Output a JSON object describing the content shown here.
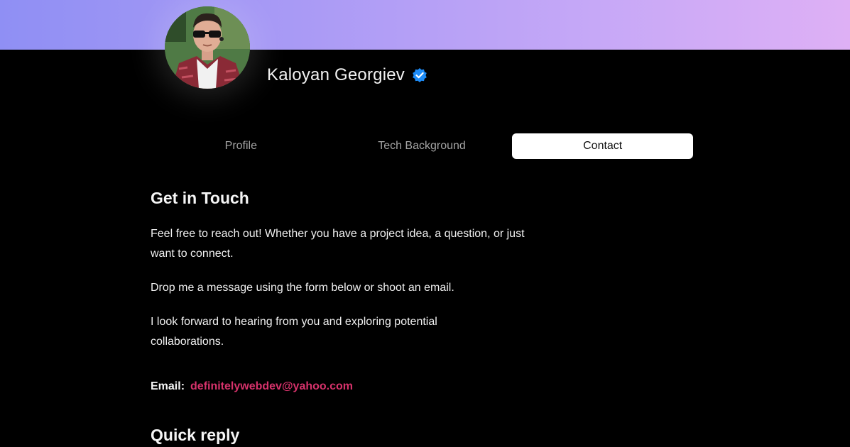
{
  "profile": {
    "name": "Kaloyan Georgiev",
    "accent": "#1d8cf8"
  },
  "tabs": [
    {
      "label": "Profile",
      "active": false
    },
    {
      "label": "Tech Background",
      "active": false
    },
    {
      "label": "Contact",
      "active": true
    }
  ],
  "contact": {
    "heading": "Get in Touch",
    "paragraphs": [
      "Feel free to reach out! Whether you have a project idea, a question, or just want to connect.",
      "Drop me a message using the form below or shoot an email.",
      "I look forward to hearing from you and exploring potential collaborations."
    ],
    "email_label": "Email:",
    "email": "definitelywebdev@yahoo.com",
    "link_color": "#d6326b",
    "quick_reply_heading": "Quick reply"
  },
  "icons": {
    "verified": "verified-badge-icon"
  }
}
